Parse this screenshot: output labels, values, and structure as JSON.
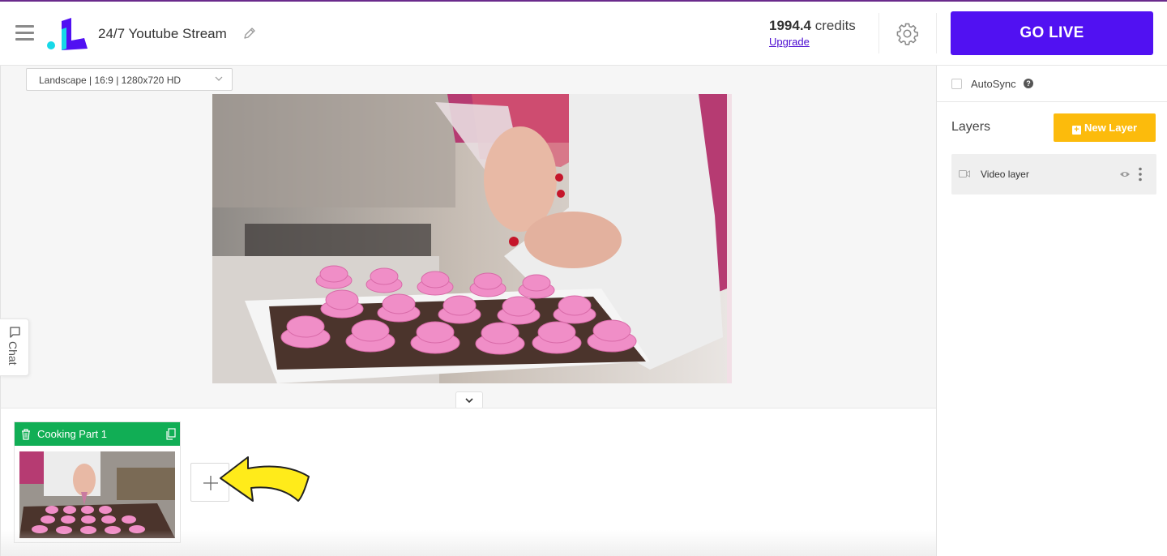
{
  "header": {
    "stream_title": "24/7 Youtube Stream",
    "credits_value": "1994.4",
    "credits_unit": "credits",
    "upgrade_label": "Upgrade",
    "go_live_label": "GO LIVE"
  },
  "canvas": {
    "resolution_value": "Landscape | 16:9 | 1280x720 HD"
  },
  "chat": {
    "label": "Chat"
  },
  "scenes": [
    {
      "name": "Cooking Part 1"
    }
  ],
  "right_panel": {
    "autosync_label": "AutoSync",
    "help_glyph": "?",
    "layers_title": "Layers",
    "new_layer_label": "New Layer",
    "new_layer_glyph": "+",
    "layers": [
      {
        "name": "Video layer"
      }
    ]
  },
  "colors": {
    "go_live": "#5111f2",
    "new_layer": "#fcbb0c",
    "scene_header": "#11ae55",
    "upgrade_link": "#4b0bd1",
    "hint_arrow": "#ffeb1a"
  },
  "icons": [
    "hamburger-icon",
    "logo",
    "pencil-icon",
    "gear-icon",
    "chevron-down-icon",
    "chat-bubble-icon",
    "trash-icon",
    "copy-icon",
    "plus-icon",
    "arrow-hint-icon",
    "help-icon",
    "video-camera-icon",
    "eye-icon",
    "more-vertical-icon"
  ]
}
